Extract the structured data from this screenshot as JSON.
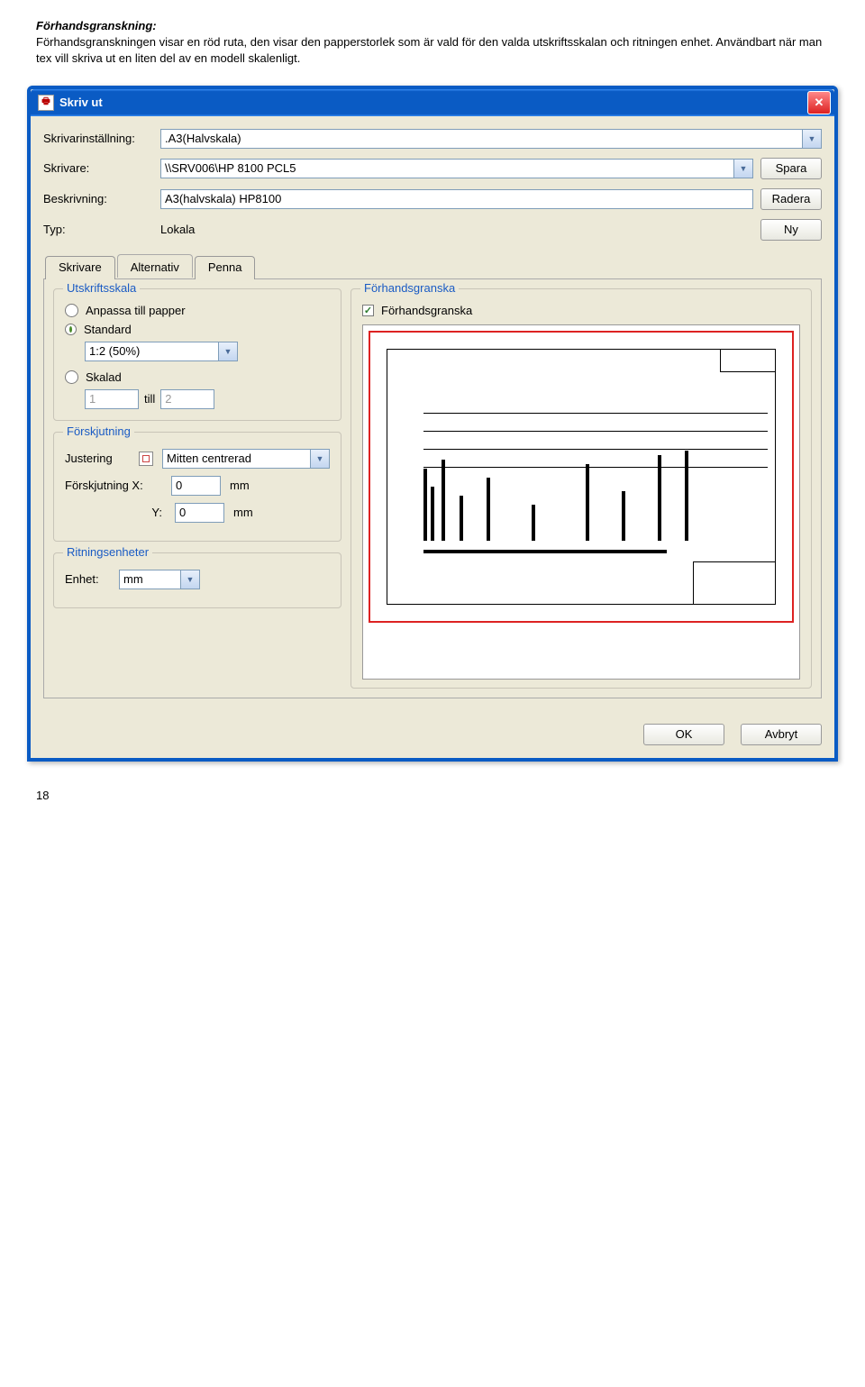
{
  "doc": {
    "heading": "Förhandsgranskning:",
    "body": "Förhandsgranskningen visar en röd ruta, den visar den papperstorlek som är vald för den valda utskriftsskalan och ritningen enhet. Användbart när man tex vill skriva ut en liten del av en modell skalenligt.",
    "page": "18"
  },
  "dialog": {
    "title": "Skriv ut"
  },
  "labels": {
    "printer_setting": "Skrivarinställning:",
    "printer": "Skrivare:",
    "description": "Beskrivning:",
    "type": "Typ:"
  },
  "values": {
    "printer_setting": ".A3(Halvskala)",
    "printer": "\\\\SRV006\\HP 8100 PCL5",
    "description": "A3(halvskala) HP8100",
    "type": "Lokala"
  },
  "buttons": {
    "save": "Spara",
    "delete": "Radera",
    "new": "Ny",
    "ok": "OK",
    "cancel": "Avbryt"
  },
  "tabs": {
    "t1": "Skrivare",
    "t2": "Alternativ",
    "t3": "Penna"
  },
  "scale": {
    "legend": "Utskriftsskala",
    "fit": "Anpassa till papper",
    "standard": "Standard",
    "scaled": "Skalad",
    "scale_value": "1:2  (50%)",
    "one": "1",
    "to": "till",
    "two": "2"
  },
  "offset": {
    "legend": "Förskjutning",
    "justify": "Justering",
    "center_label": "Mitten centrerad",
    "xlabel": "Förskjutning  X:",
    "ylabel": "Y:",
    "x": "0",
    "y": "0",
    "unit": "mm"
  },
  "units": {
    "legend": "Ritningsenheter",
    "label": "Enhet:",
    "value": "mm"
  },
  "preview": {
    "legend": "Förhandsgranska",
    "chk": "Förhandsgranska"
  }
}
